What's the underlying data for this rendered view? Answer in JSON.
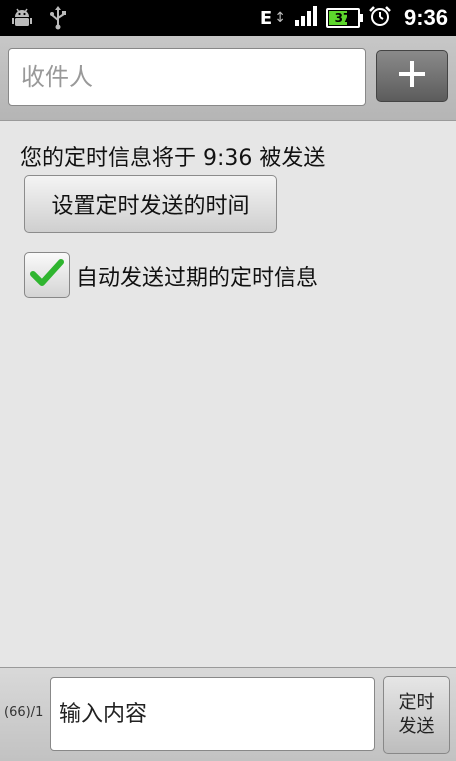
{
  "status_bar": {
    "icons_left": [
      "android-debug-icon",
      "usb-icon"
    ],
    "network_type": "E",
    "network_arrows": "↕",
    "battery_level": "37",
    "battery_color": "#5dd62c",
    "alarm_icon": "alarm-clock-icon",
    "time": "9:36"
  },
  "recipient": {
    "placeholder": "收件人",
    "add_button_icon": "plus-icon"
  },
  "schedule": {
    "info_text": "您的定时信息将于 9:36 被发送",
    "set_time_button": "设置定时发送的时间",
    "auto_send_label": "自动发送过期的定时信息",
    "auto_send_checked": true,
    "check_color": "#2fb52f"
  },
  "compose": {
    "char_count": "(66)/1",
    "placeholder": "输入内容",
    "send_line1": "定时",
    "send_line2": "发送"
  }
}
